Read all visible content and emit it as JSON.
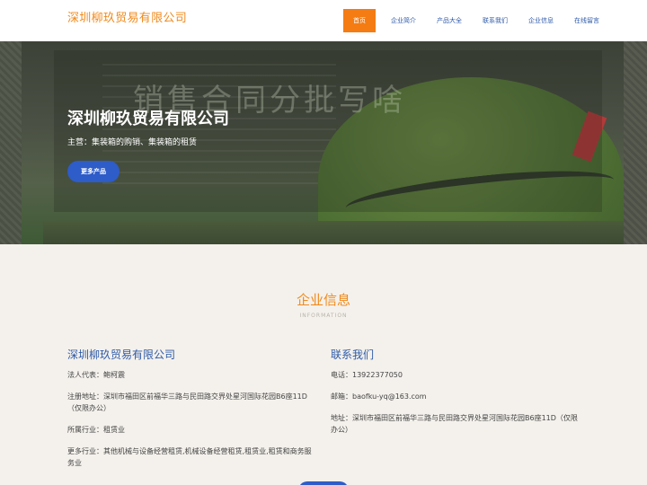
{
  "header": {
    "brand": "深圳柳玖贸易有限公司",
    "nav": [
      {
        "label": "首页",
        "active": true
      },
      {
        "label": "企业简介"
      },
      {
        "label": "产品大全"
      },
      {
        "label": "联系我们"
      },
      {
        "label": "企业信息"
      },
      {
        "label": "在线留言"
      }
    ]
  },
  "hero": {
    "title": "深圳柳玖贸易有限公司",
    "subtitle": "主营：集装箱的购销、集装箱的租赁",
    "button_label": "更多产品",
    "watermark": "销售合同分批写啥"
  },
  "info": {
    "title": "企业信息",
    "subtitle": "INFORMATION",
    "left": {
      "heading": "深圳柳玖贸易有限公司",
      "lines": [
        "法人代表：鲍柯震",
        "注册地址：深圳市福田区前福华三路与民田路交界处星河国际花园B6座11D（仅限办公）",
        "所属行业：租赁业",
        "更多行业：其他机械与设备经营租赁,机械设备经营租赁,租赁业,租赁和商务服务业"
      ]
    },
    "right": {
      "heading": "联系我们",
      "lines": [
        "电话：13922377050",
        "邮箱：baofku-yq@163.com",
        "地址：深圳市福田区前福华三路与民田路交界处星河国际花园B6座11D（仅限办公）"
      ]
    }
  },
  "colors": {
    "accent": "#f47c13",
    "link": "#2e5aa8",
    "button": "#2e5cc8",
    "background": "#f4f1ec"
  }
}
